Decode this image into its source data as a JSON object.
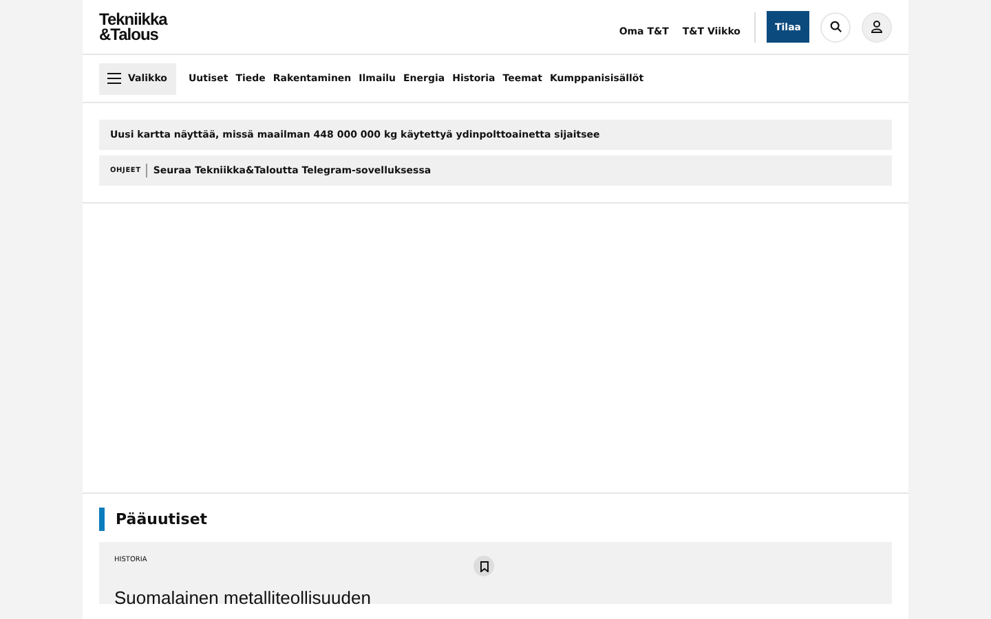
{
  "logo": {
    "line_1": "Tekniikka",
    "line_2": "&Talous"
  },
  "header_links": [
    "Oma T&T",
    "T&T Viikko"
  ],
  "subscribe_button": "Tilaa",
  "nav": {
    "menu_button": "Valikko",
    "items": [
      "Uutiset",
      "Tiede",
      "Rakentaminen",
      "Ilmailu",
      "Energia",
      "Historia",
      "Teemat",
      "Kumppanisisällöt"
    ]
  },
  "notices": [
    {
      "kind": "plain",
      "text": "Uusi kartta näyttää, missä maailman 448 000 000 kg käytettyä ydinpolttoainetta sijaitsee"
    },
    {
      "kind": "tagged",
      "tag": "OHJEET",
      "text": "Seuraa Tekniikka&Taloutta Telegram-sovelluksessa"
    }
  ],
  "section": {
    "title": "Pääuutiset",
    "article": {
      "category": "HISTORIA",
      "headline": "Suomalainen metalliteollisuuden"
    }
  }
}
